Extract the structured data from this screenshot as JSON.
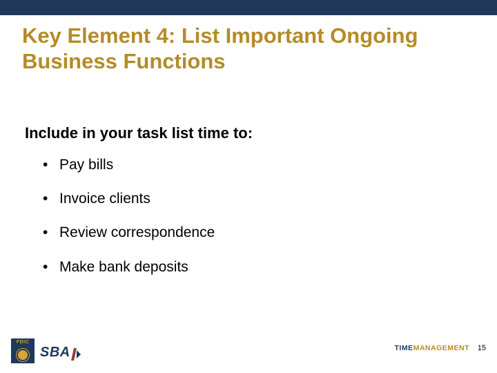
{
  "title": "Key Element 4: List Important Ongoing Business Functions",
  "subtitle": "Include in your task list time to:",
  "bullets": [
    "Pay bills",
    "Invoice clients",
    "Review correspondence",
    "Make bank deposits"
  ],
  "footer": {
    "word1": "TIME",
    "word2": "MANAGEMENT",
    "page": "15",
    "fdic": "FDIC",
    "sba": "SBA"
  }
}
